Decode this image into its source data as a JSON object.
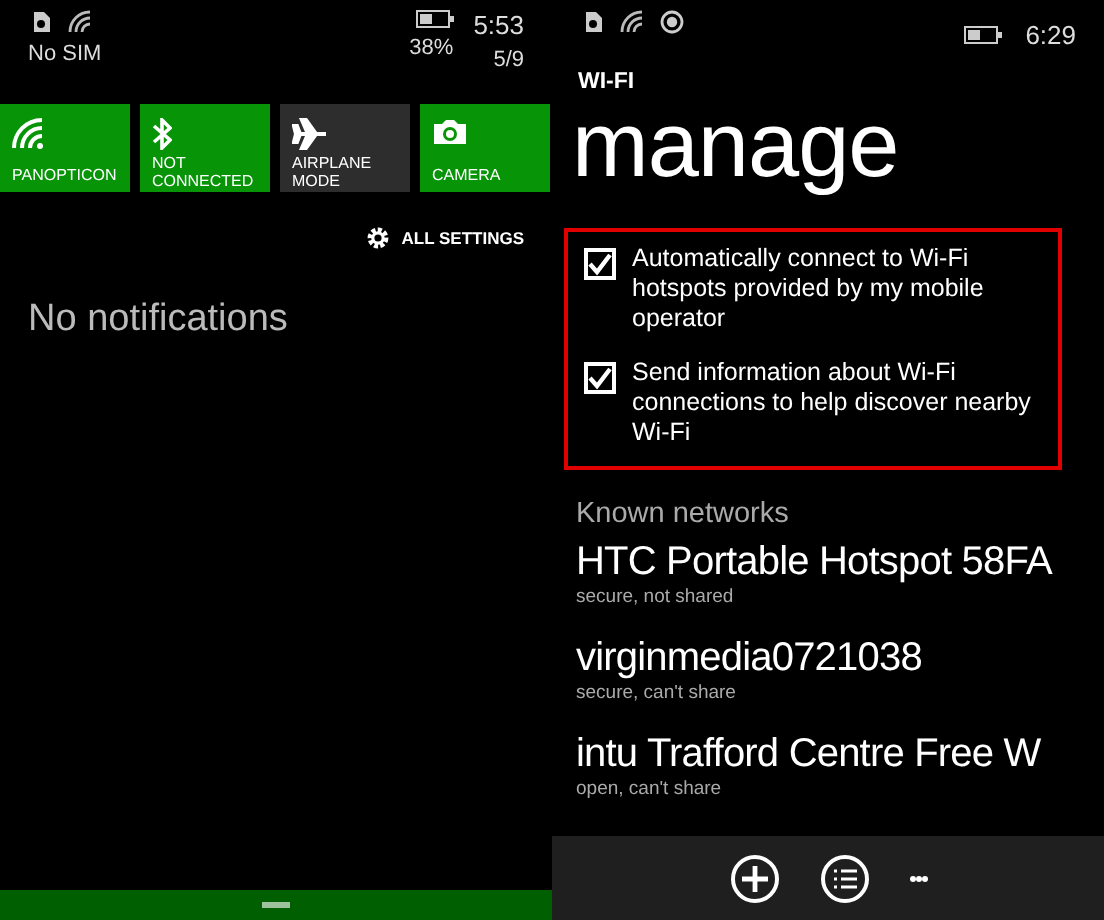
{
  "left": {
    "status": {
      "carrier": "No SIM",
      "battery_percent": "38%",
      "time": "5:53",
      "date": "5/9"
    },
    "quick_actions": [
      {
        "kind": "wifi",
        "label": "PANOPTICON",
        "on": true
      },
      {
        "kind": "bluetooth",
        "label": "NOT CONNECTED",
        "on": true
      },
      {
        "kind": "airplane",
        "label": "AIRPLANE MODE",
        "on": false
      },
      {
        "kind": "camera",
        "label": "CAMERA",
        "on": true
      }
    ],
    "all_settings": "ALL SETTINGS",
    "notifications": "No notifications"
  },
  "right": {
    "status": {
      "time": "6:29"
    },
    "app_title": "WI-FI",
    "page_title": "manage",
    "options": [
      {
        "label": "Automatically connect to Wi-Fi hotspots provided by my mobile operator",
        "checked": true
      },
      {
        "label": "Send information about Wi-Fi connections to help discover nearby Wi-Fi",
        "checked": true
      }
    ],
    "known_networks_heading": "Known networks",
    "networks": [
      {
        "name": "HTC Portable Hotspot 58FA",
        "detail": "secure, not shared"
      },
      {
        "name": "virginmedia0721038",
        "detail": "secure, can't share"
      },
      {
        "name": "intu Trafford Centre Free W",
        "detail": "open, can't share"
      }
    ]
  }
}
